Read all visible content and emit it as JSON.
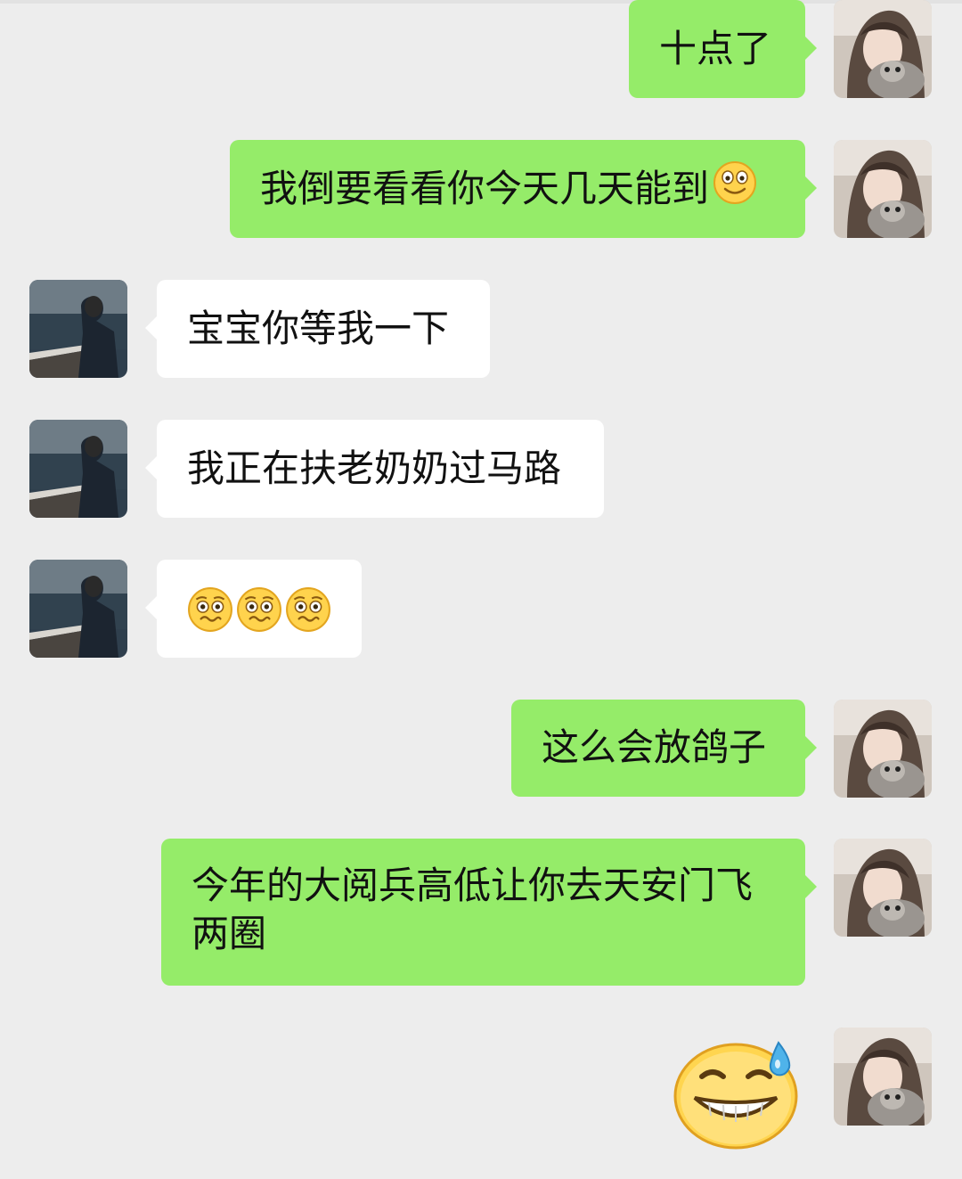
{
  "chat": {
    "messages": [
      {
        "sender": "me",
        "text": "十点了"
      },
      {
        "sender": "me",
        "text": "我倒要看看你今天几天能到",
        "emoji_after": "smile-emoji"
      },
      {
        "sender": "them",
        "text": "宝宝你等我一下"
      },
      {
        "sender": "them",
        "text": "我正在扶老奶奶过马路"
      },
      {
        "sender": "them",
        "emojis": [
          "pleading-emoji",
          "pleading-emoji",
          "pleading-emoji"
        ]
      },
      {
        "sender": "me",
        "text": "这么会放鸽子"
      },
      {
        "sender": "me",
        "text_line1": "今年的大阅兵高低让你去天安门飞",
        "text_line2": "两圈"
      },
      {
        "sender": "me",
        "sticker": "awkward-grin-sweat-emoji"
      }
    ]
  },
  "colors": {
    "background": "#ededed",
    "my_bubble": "#95ec69",
    "their_bubble": "#ffffff"
  }
}
